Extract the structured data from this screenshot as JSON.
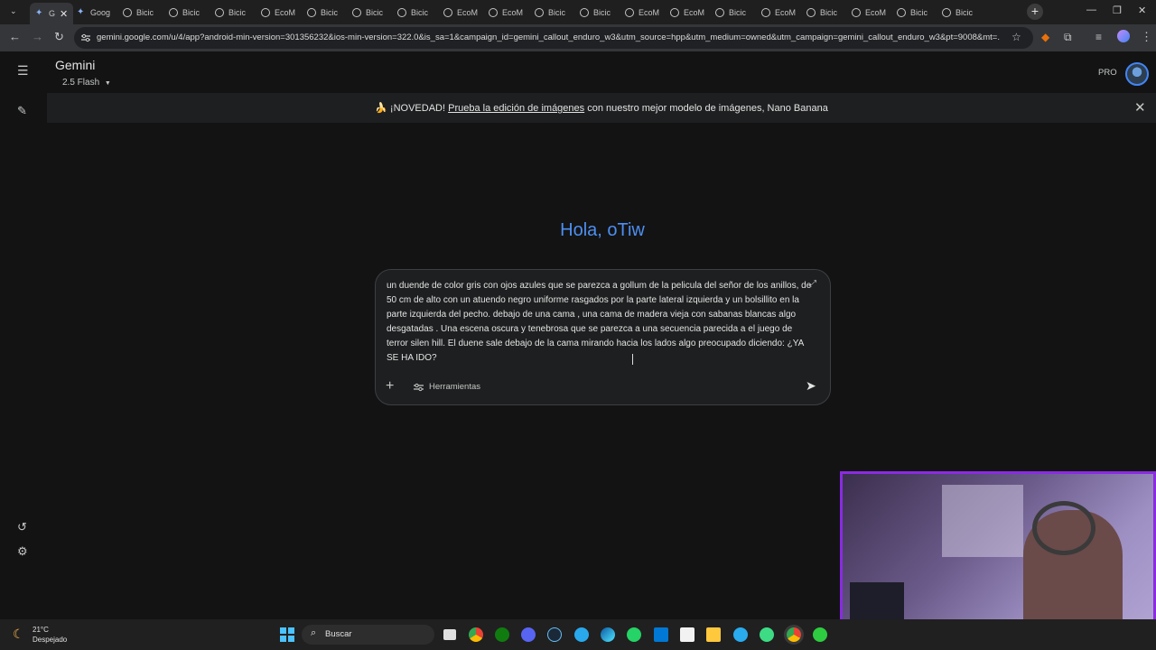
{
  "browser": {
    "tabs": [
      {
        "label": "G",
        "icon": "gemini-sparkle-icon",
        "active": true
      },
      {
        "label": "Goog",
        "icon": "gemini-sparkle-icon"
      },
      {
        "label": "Bicic",
        "icon": "globe-icon"
      },
      {
        "label": "Bicic",
        "icon": "globe-icon"
      },
      {
        "label": "Bicic",
        "icon": "globe-icon"
      },
      {
        "label": "EcoM",
        "icon": "globe-icon"
      },
      {
        "label": "Bicic",
        "icon": "globe-icon"
      },
      {
        "label": "Bicic",
        "icon": "globe-icon"
      },
      {
        "label": "Bicic",
        "icon": "globe-icon"
      },
      {
        "label": "EcoM",
        "icon": "globe-icon"
      },
      {
        "label": "EcoM",
        "icon": "globe-icon"
      },
      {
        "label": "Bicic",
        "icon": "globe-icon"
      },
      {
        "label": "Bicic",
        "icon": "globe-icon"
      },
      {
        "label": "EcoM",
        "icon": "globe-icon"
      },
      {
        "label": "EcoM",
        "icon": "globe-icon"
      },
      {
        "label": "Bicic",
        "icon": "globe-icon"
      },
      {
        "label": "EcoM",
        "icon": "globe-icon"
      },
      {
        "label": "Bicic",
        "icon": "globe-icon"
      },
      {
        "label": "EcoM",
        "icon": "globe-icon"
      },
      {
        "label": "Bicic",
        "icon": "globe-icon"
      },
      {
        "label": "Bicic",
        "icon": "globe-icon"
      }
    ],
    "url": "gemini.google.com/u/4/app?android-min-version=301356232&ios-min-version=322.0&is_sa=1&campaign_id=gemini_callout_enduro_w3&utm_source=hpp&utm_medium=owned&utm_campaign=gemini_callout_enduro_w3&pt=9008&mt=..."
  },
  "header": {
    "title": "Gemini",
    "model": "2.5 Flash",
    "pro_label": "PRO"
  },
  "banner": {
    "emoji": "🍌",
    "prefix": "¡NOVEDAD!",
    "link": "Prueba la edición de imágenes",
    "suffix": "con nuestro mejor modelo de imágenes, Nano Banana"
  },
  "greeting": "Hola, oTiw",
  "prompt": {
    "text": "un duende de color gris con ojos azules que se parezca a gollum de la pelicula del señor de los anillos, de 50 cm de alto con un atuendo negro uniforme rasgados por la parte lateral izquierda y un bolsillito en la parte  izquierda del pecho. debajo de una cama , una cama de madera vieja con sabanas blancas algo desgatadas . Una escena oscura y tenebrosa que se parezca a una secuencia parecida a el juego de terror silen hill. El duene sale debajo de la cama mirando hacia los lados algo preocupado diciendo: ¿YA SE HA IDO?",
    "tools_label": "Herramientas"
  },
  "taskbar": {
    "temperature": "21°C",
    "weather": "Despejado",
    "search_label": "Buscar"
  },
  "colors": {
    "background": "#131314",
    "greeting_blue": "#4d8ff0",
    "webcam_border": "#8a2be2"
  }
}
